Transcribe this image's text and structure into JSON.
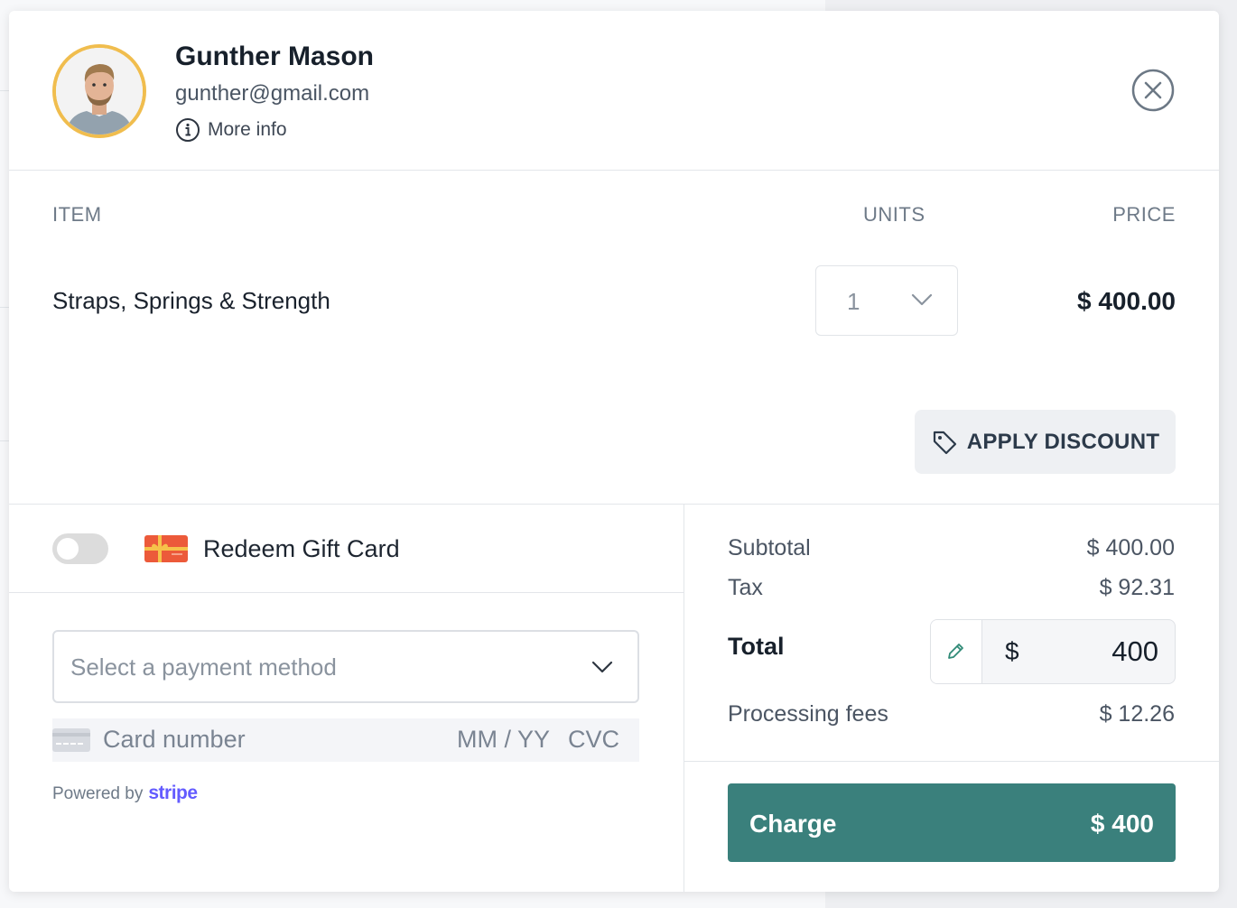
{
  "customer": {
    "name": "Gunther Mason",
    "email": "gunther@gmail.com",
    "more_info_label": "More info",
    "avatar_ring_color": "#f0bd4e"
  },
  "table": {
    "headers": {
      "item": "ITEM",
      "units": "UNITS",
      "price": "PRICE"
    },
    "rows": [
      {
        "item": "Straps, Springs & Strength",
        "units": "1",
        "price": "$ 400.00"
      }
    ]
  },
  "discount": {
    "label": "APPLY DISCOUNT",
    "icon": "tag-icon"
  },
  "gift_card": {
    "label": "Redeem Gift Card",
    "enabled": false
  },
  "payment": {
    "placeholder": "Select a payment method",
    "card_number_placeholder": "Card number",
    "expiry_placeholder": "MM / YY",
    "cvc_placeholder": "CVC",
    "powered_by": "Powered by",
    "provider": "stripe"
  },
  "summary": {
    "subtotal_label": "Subtotal",
    "subtotal_value": "$ 400.00",
    "tax_label": "Tax",
    "tax_value": "$ 92.31",
    "total_label": "Total",
    "total_currency": "$",
    "total_value": "400",
    "processing_label": "Processing fees",
    "processing_value": "$ 12.26"
  },
  "charge": {
    "label": "Charge",
    "amount": "$ 400",
    "color": "#3a807c"
  }
}
